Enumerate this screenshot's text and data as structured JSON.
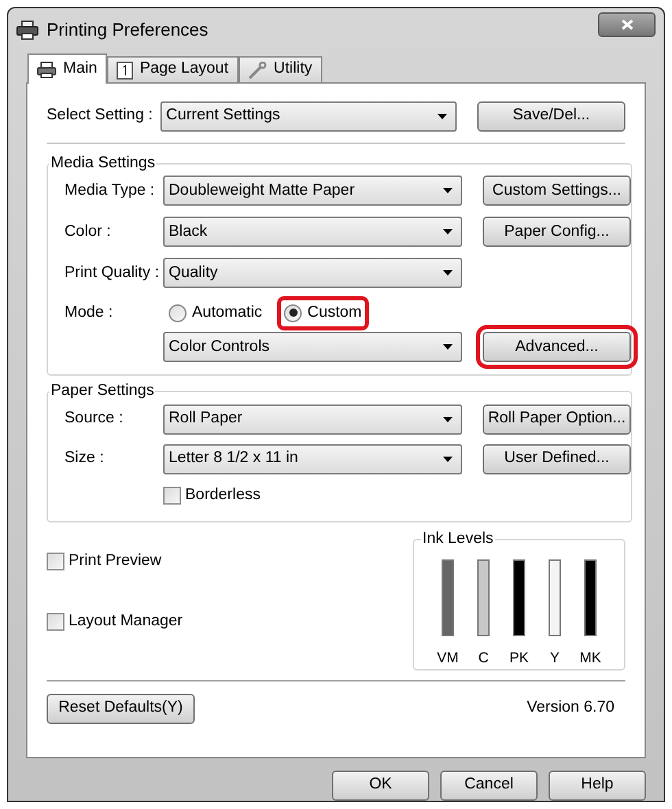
{
  "window": {
    "title": "Printing Preferences"
  },
  "tabs": [
    {
      "label": "Main",
      "selected": true
    },
    {
      "label": "Page Layout",
      "selected": false
    },
    {
      "label": "Utility",
      "selected": false
    }
  ],
  "select_setting": {
    "label": "Select Setting :",
    "value": "Current Settings",
    "button": "Save/Del..."
  },
  "media_settings": {
    "title": "Media Settings",
    "rows": [
      {
        "label": "Media Type :",
        "value": "Doubleweight Matte Paper",
        "button": "Custom Settings..."
      },
      {
        "label": "Color :",
        "value": "Black",
        "button": "Paper Config..."
      },
      {
        "label": "Print Quality :",
        "value": "Quality"
      }
    ],
    "mode": {
      "label": "Mode :",
      "options": [
        {
          "label": "Automatic",
          "selected": false,
          "highlighted": false
        },
        {
          "label": "Custom",
          "selected": true,
          "highlighted": true
        }
      ],
      "value": "Color Controls",
      "button": "Advanced...",
      "button_highlighted": true
    }
  },
  "paper_settings": {
    "title": "Paper Settings",
    "rows": [
      {
        "label": "Source :",
        "value": "Roll Paper",
        "button": "Roll Paper Option..."
      },
      {
        "label": "Size :",
        "value": "Letter 8 1/2 x 11 in",
        "button": "User Defined..."
      }
    ],
    "borderless": {
      "label": "Borderless",
      "checked": false
    }
  },
  "options": [
    {
      "label": "Print Preview",
      "checked": false
    },
    {
      "label": "Layout Manager",
      "checked": false
    }
  ],
  "ink_levels": {
    "title": "Ink Levels",
    "inks": [
      {
        "name": "VM",
        "color": "#666666",
        "level": 1
      },
      {
        "name": "C",
        "color": "#c8c8c8",
        "level": 1
      },
      {
        "name": "PK",
        "color": "#000000",
        "level": 1
      },
      {
        "name": "Y",
        "color": "#f4f4f4",
        "level": 1
      },
      {
        "name": "MK",
        "color": "#000000",
        "level": 1
      }
    ]
  },
  "reset_button": "Reset Defaults(Y)",
  "version": "Version 6.70",
  "buttons": [
    "OK",
    "Cancel",
    "Help"
  ]
}
